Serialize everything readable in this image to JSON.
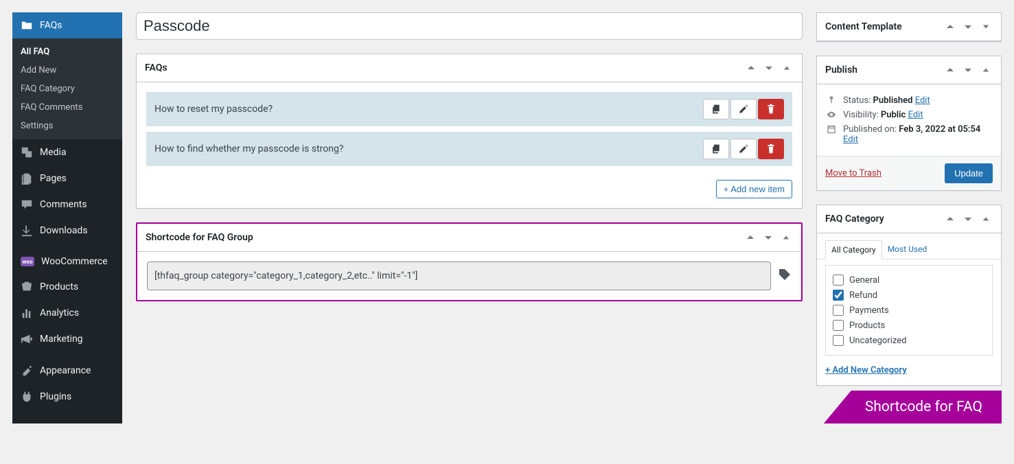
{
  "sidebar": {
    "current_label": "FAQs",
    "sub_items": [
      {
        "label": "All FAQ",
        "current": true
      },
      {
        "label": "Add New"
      },
      {
        "label": "FAQ Category"
      },
      {
        "label": "FAQ Comments"
      },
      {
        "label": "Settings"
      }
    ],
    "items": [
      {
        "label": "Media",
        "icon": "media"
      },
      {
        "label": "Pages",
        "icon": "pages"
      },
      {
        "label": "Comments",
        "icon": "comment"
      },
      {
        "label": "Downloads",
        "icon": "download"
      },
      {
        "label": "WooCommerce",
        "icon": "woo",
        "sep_before": true
      },
      {
        "label": "Products",
        "icon": "products"
      },
      {
        "label": "Analytics",
        "icon": "analytics"
      },
      {
        "label": "Marketing",
        "icon": "marketing"
      },
      {
        "label": "Appearance",
        "icon": "appearance",
        "sep_before": true
      },
      {
        "label": "Plugins",
        "icon": "plugins"
      }
    ]
  },
  "title": "Passcode",
  "faqs_box_title": "FAQs",
  "faqs": [
    {
      "question": "How to reset my passcode?"
    },
    {
      "question": "How to find whether my passcode is strong?"
    }
  ],
  "add_new_item": "+ Add new item",
  "shortcode_box_title": "Shortcode for FAQ Group",
  "shortcode_value": "[thfaq_group category=\"category_1,category_2,etc..\" limit=\"-1\"]",
  "content_template_title": "Content Template",
  "publish": {
    "title": "Publish",
    "status_label": "Status: ",
    "status_value": "Published",
    "visibility_label": "Visibility: ",
    "visibility_value": "Public",
    "published_label": "Published on: ",
    "published_value": "Feb 3, 2022 at 05:54",
    "edit": "Edit",
    "trash": "Move to Trash",
    "update": "Update"
  },
  "faq_category": {
    "title": "FAQ Category",
    "tab_all": "All Category",
    "tab_most": "Most Used",
    "items": [
      {
        "label": "General",
        "checked": false
      },
      {
        "label": "Refund",
        "checked": true
      },
      {
        "label": "Payments",
        "checked": false
      },
      {
        "label": "Products",
        "checked": false
      },
      {
        "label": "Uncategorized",
        "checked": false
      }
    ],
    "add_new": "+ Add New Category"
  },
  "bottom_tag": "Shortcode for FAQ"
}
